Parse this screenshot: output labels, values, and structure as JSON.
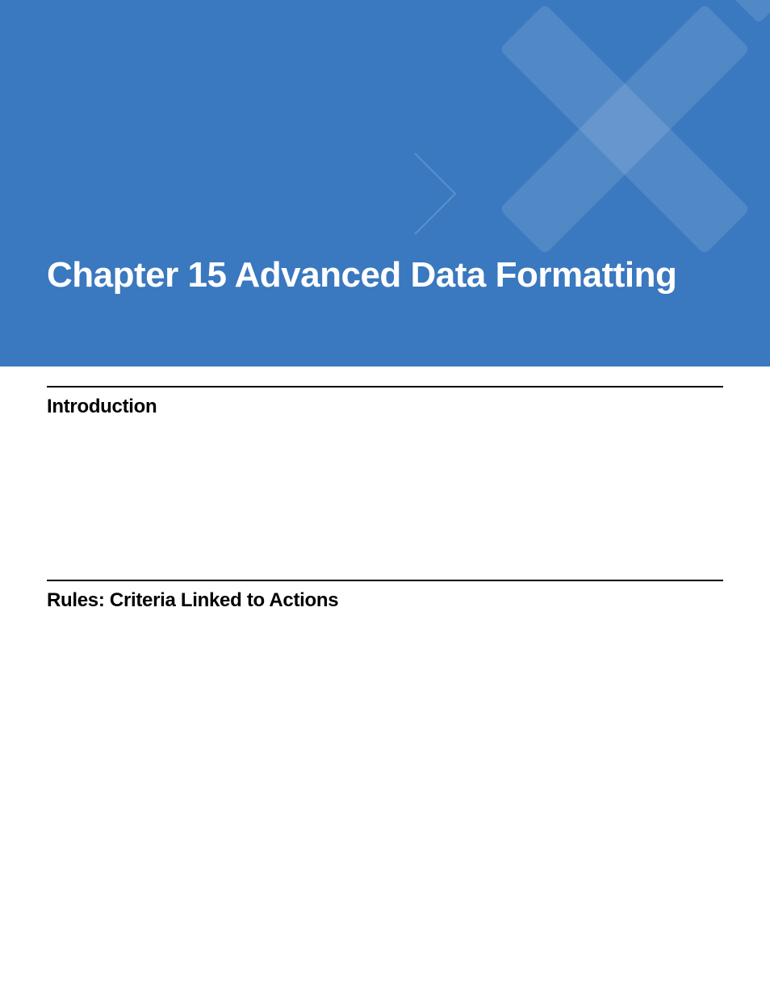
{
  "banner": {
    "title": "Chapter 15 Advanced Data Formatting"
  },
  "sections": [
    {
      "heading": "Introduction"
    },
    {
      "heading": "Rules: Criteria Linked to Actions"
    }
  ]
}
